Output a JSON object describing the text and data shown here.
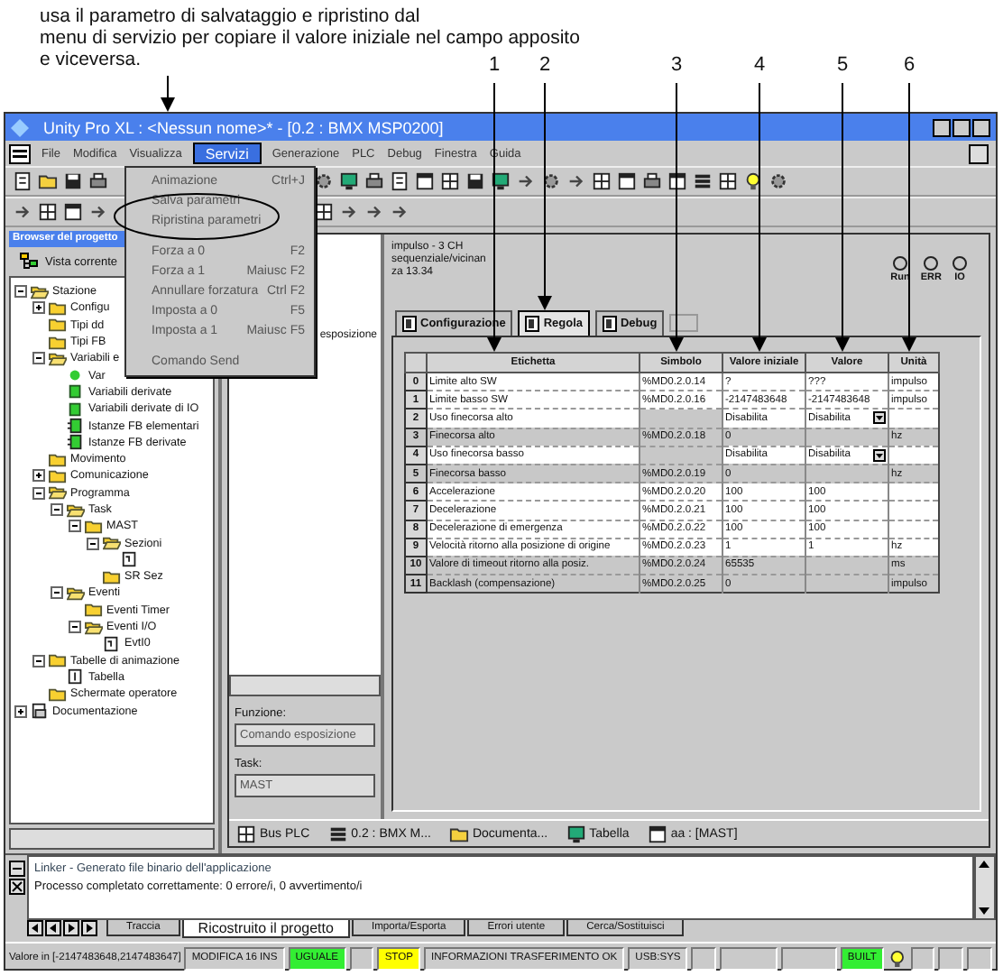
{
  "caption_lines": [
    "usa il parametro di salvataggio e ripristino dal",
    "menu di servizio per copiare il valore iniziale nel campo apposito",
    "e viceversa."
  ],
  "callouts": [
    "1",
    "2",
    "3",
    "4",
    "5",
    "6"
  ],
  "window": {
    "title": "Unity Pro XL : <Nessun nome>* - [0.2 : BMX MSP0200]"
  },
  "menu_bar": [
    {
      "label": "File",
      "selected": false
    },
    {
      "label": "Modifica",
      "selected": false
    },
    {
      "label": "Visualizza",
      "selected": false
    },
    {
      "label": "Servizi",
      "selected": true
    },
    {
      "label": "Generazione",
      "selected": false
    },
    {
      "label": "PLC",
      "selected": false
    },
    {
      "label": "Debug",
      "selected": false
    },
    {
      "label": "Finestra",
      "selected": false
    },
    {
      "label": "Guida",
      "selected": false
    }
  ],
  "services_menu": [
    {
      "kind": "item",
      "label": "Animazione",
      "shortcut": "Ctrl+J"
    },
    {
      "kind": "item",
      "label": "Salva parametri"
    },
    {
      "kind": "item",
      "label": "Ripristina parametri"
    },
    {
      "kind": "separator"
    },
    {
      "kind": "item",
      "label": "Forza a 0",
      "shortcut": "F2"
    },
    {
      "kind": "item",
      "label": "Forza a 1",
      "shortcut": "Maiusc F2"
    },
    {
      "kind": "item",
      "label": "Annullare forzatura",
      "shortcut": "Ctrl F2"
    },
    {
      "kind": "item",
      "label": "Imposta a 0",
      "shortcut": "F5"
    },
    {
      "kind": "item",
      "label": "Imposta a 1",
      "shortcut": "Maiusc F5"
    },
    {
      "kind": "separator"
    },
    {
      "kind": "item",
      "label": "Comando Send"
    }
  ],
  "browser": {
    "title": "Browser del progetto",
    "view": "Vista corrente",
    "tree": [
      {
        "label": "Stazione",
        "kind": "open-folder",
        "expanded": true,
        "children": [
          {
            "label": "Configu",
            "kind": "folder",
            "expanded": false
          },
          {
            "label": "Tipi dd",
            "kind": "folder"
          },
          {
            "label": "Tipi FB",
            "kind": "folder"
          },
          {
            "label": "Variabili e",
            "kind": "open-folder",
            "expanded": true,
            "children": [
              {
                "label": "Var",
                "kind": "dot"
              },
              {
                "label": "Variabili derivate",
                "kind": "block"
              },
              {
                "label": "Variabili derivate di IO",
                "kind": "block"
              },
              {
                "label": "Istanze FB elementari",
                "kind": "fb"
              },
              {
                "label": "Istanze FB derivate",
                "kind": "fb"
              }
            ]
          },
          {
            "label": "Movimento",
            "kind": "folder"
          },
          {
            "label": "Comunicazione",
            "kind": "folder",
            "expanded": false
          },
          {
            "label": "Programma",
            "kind": "open-folder",
            "expanded": true,
            "children": [
              {
                "label": "Task",
                "kind": "open-folder",
                "expanded": true,
                "children": [
                  {
                    "label": "MAST",
                    "kind": "folder",
                    "expanded": true,
                    "children": [
                      {
                        "label": "Sezioni",
                        "kind": "open-folder",
                        "expanded": true,
                        "children": [
                          {
                            "kind": "section"
                          }
                        ]
                      },
                      {
                        "label": "SR Sez",
                        "kind": "folder"
                      }
                    ]
                  }
                ]
              },
              {
                "label": "Eventi",
                "kind": "open-folder",
                "expanded": true,
                "children": [
                  {
                    "label": "Eventi Timer",
                    "kind": "folder"
                  },
                  {
                    "label": "Eventi I/O",
                    "kind": "open-folder",
                    "expanded": true,
                    "children": [
                      {
                        "label": "EvtI0",
                        "kind": "section"
                      }
                    ]
                  }
                ]
              }
            ]
          },
          {
            "label": "Tabelle di animazione",
            "kind": "folder",
            "expanded": true,
            "children": [
              {
                "label": "Tabella",
                "kind": "table"
              }
            ]
          },
          {
            "label": "Schermate operatore",
            "kind": "folder"
          }
        ]
      },
      {
        "label": "Documentazione",
        "kind": "documentation",
        "expanded": false
      }
    ]
  },
  "editor": {
    "left_panel": {
      "text": "esposizione",
      "function_label": "Funzione:",
      "function_value": "Comando esposizione",
      "task_label": "Task:",
      "task_value": "MAST"
    },
    "header": "impulso - 3 CH sequenziale/vicinanza 13.34",
    "leds": [
      {
        "label": "Run",
        "on": false
      },
      {
        "label": "ERR",
        "on": false
      },
      {
        "label": "IO",
        "on": false
      }
    ],
    "tabs": [
      {
        "label": "Configurazione",
        "selected": false
      },
      {
        "label": "Regola",
        "selected": true
      },
      {
        "label": "Debug",
        "selected": false
      }
    ],
    "table": {
      "columns": [
        "Etichetta",
        "Simbolo",
        "Valore iniziale",
        "Valore",
        "Unità"
      ],
      "rows": [
        {
          "index": "0",
          "label": "Limite alto SW",
          "symbol": "%MD0.2.0.14",
          "initial": "?",
          "value": "???",
          "unit": "impulso",
          "shaded": false,
          "kind": "text"
        },
        {
          "index": "1",
          "label": "Limite basso SW",
          "symbol": "%MD0.2.0.16",
          "initial": "-2147483648",
          "value": "-2147483648",
          "unit": "impulso",
          "shaded": false,
          "kind": "text"
        },
        {
          "index": "2",
          "label": "Uso finecorsa alto",
          "initial": "Disabilita",
          "value": "Disabilita",
          "shaded": false,
          "kind": "dropdown"
        },
        {
          "index": "3",
          "label": "Finecorsa alto",
          "symbol": "%MD0.2.0.18",
          "initial": "0",
          "unit": "hz",
          "shaded": true,
          "kind": "text"
        },
        {
          "index": "4",
          "label": "Uso finecorsa basso",
          "initial": "Disabilita",
          "value": "Disabilita",
          "shaded": false,
          "kind": "dropdown"
        },
        {
          "index": "5",
          "label": "Finecorsa basso",
          "symbol": "%MD0.2.0.19",
          "initial": "0",
          "unit": "hz",
          "shaded": true,
          "kind": "text"
        },
        {
          "index": "6",
          "label": "Accelerazione",
          "symbol": "%MD0.2.0.20",
          "initial": "100",
          "value": "100",
          "shaded": false,
          "kind": "text"
        },
        {
          "index": "7",
          "label": "Decelerazione",
          "symbol": "%MD0.2.0.21",
          "initial": "100",
          "value": "100",
          "shaded": false,
          "kind": "text"
        },
        {
          "index": "8",
          "label": "Decelerazione di emergenza",
          "symbol": "%MD0.2.0.22",
          "initial": "100",
          "value": "100",
          "shaded": false,
          "kind": "text"
        },
        {
          "index": "9",
          "label": "Velocità ritorno alla posizione di origine",
          "symbol": "%MD0.2.0.23",
          "initial": "1",
          "value": "1",
          "unit": "hz",
          "shaded": false,
          "kind": "text"
        },
        {
          "index": "10",
          "label": "Valore di timeout ritorno alla posiz.",
          "symbol": "%MD0.2.0.24",
          "initial": "65535",
          "unit": "ms",
          "shaded": true,
          "kind": "text"
        },
        {
          "index": "11",
          "label": "Backlash (compensazione)",
          "symbol": "%MD0.2.0.25",
          "initial": "0",
          "unit": "impulso",
          "shaded": true,
          "kind": "text"
        }
      ]
    },
    "bottom_tabs": [
      "Bus PLC",
      "0.2 : BMX M...",
      "Documenta...",
      "Tabella",
      "aa : [MAST]"
    ]
  },
  "output": {
    "lines": [
      "Linker - Generato file binario dell'applicazione",
      "Processo completato correttamente: 0 errore/i, 0 avvertimento/i"
    ],
    "tabs": [
      {
        "label": "Traccia",
        "selected": false
      },
      {
        "label": "Ricostruito il progetto",
        "selected": true
      },
      {
        "label": "Importa/Esporta",
        "selected": false
      },
      {
        "label": "Errori utente",
        "selected": false
      },
      {
        "label": "Cerca/Sostituisci",
        "selected": false
      }
    ]
  },
  "status_bar": [
    {
      "kind": "message",
      "text": "Valore in [-2147483648,2147483647]"
    },
    {
      "kind": "panel",
      "text": "MODIFICA 16 INS",
      "color": "#cccccc"
    },
    {
      "kind": "panel",
      "text": "UGUALE",
      "color": "#33ee33"
    },
    {
      "kind": "panel",
      "text": "STOP",
      "color": "#ffff00"
    },
    {
      "kind": "panel",
      "text": "INFORMAZIONI TRASFERIMENTO OK",
      "color": "#cccccc"
    },
    {
      "kind": "panel",
      "text": "USB:SYS",
      "color": "#cccccc"
    },
    {
      "kind": "panel",
      "text": "BUILT",
      "color": "#33ee33"
    }
  ]
}
